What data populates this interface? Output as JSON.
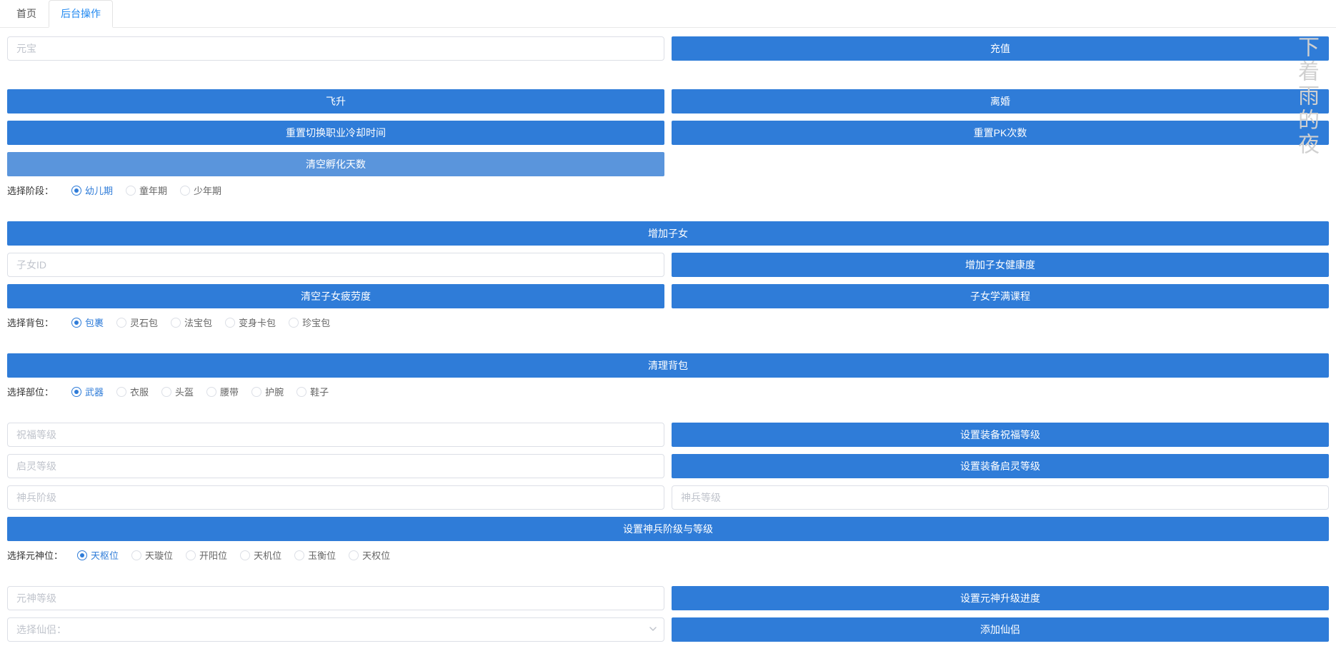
{
  "watermark": "下着雨的夜",
  "tabs": {
    "home": "首页",
    "ops": "后台操作"
  },
  "inputs": {
    "yuanbao_ph": "元宝",
    "child_id_ph": "子女ID",
    "bless_level_ph": "祝福等级",
    "spirit_level_ph": "启灵等级",
    "weapon_stage_ph": "神兵阶级",
    "weapon_level_ph": "神兵等级",
    "yuanshen_level_ph": "元神等级",
    "select_partner_ph": "选择仙侣："
  },
  "buttons": {
    "recharge": "充值",
    "ascend": "飞升",
    "divorce": "离婚",
    "reset_job_cd": "重置切换职业冷却时间",
    "reset_pk": "重置PK次数",
    "clear_hatch": "清空孵化天数",
    "add_child": "增加子女",
    "add_child_health": "增加子女健康度",
    "clear_child_fatigue": "清空子女疲劳度",
    "child_full_course": "子女学满课程",
    "clear_bag": "清理背包",
    "set_equip_bless": "设置装备祝福等级",
    "set_equip_spirit": "设置装备启灵等级",
    "set_weapon_stage_level": "设置神兵阶级与等级",
    "set_yuanshen_progress": "设置元神升级进度",
    "add_partner": "添加仙侣"
  },
  "labels": {
    "select_stage": "选择阶段：",
    "select_bag": "选择背包：",
    "select_part": "选择部位：",
    "select_yuanshen": "选择元神位："
  },
  "radios": {
    "stage": [
      "幼儿期",
      "童年期",
      "少年期"
    ],
    "bag": [
      "包裹",
      "灵石包",
      "法宝包",
      "变身卡包",
      "珍宝包"
    ],
    "part": [
      "武器",
      "衣服",
      "头盔",
      "腰带",
      "护腕",
      "鞋子"
    ],
    "yuanshen": [
      "天枢位",
      "天璇位",
      "开阳位",
      "天机位",
      "玉衡位",
      "天权位"
    ]
  }
}
